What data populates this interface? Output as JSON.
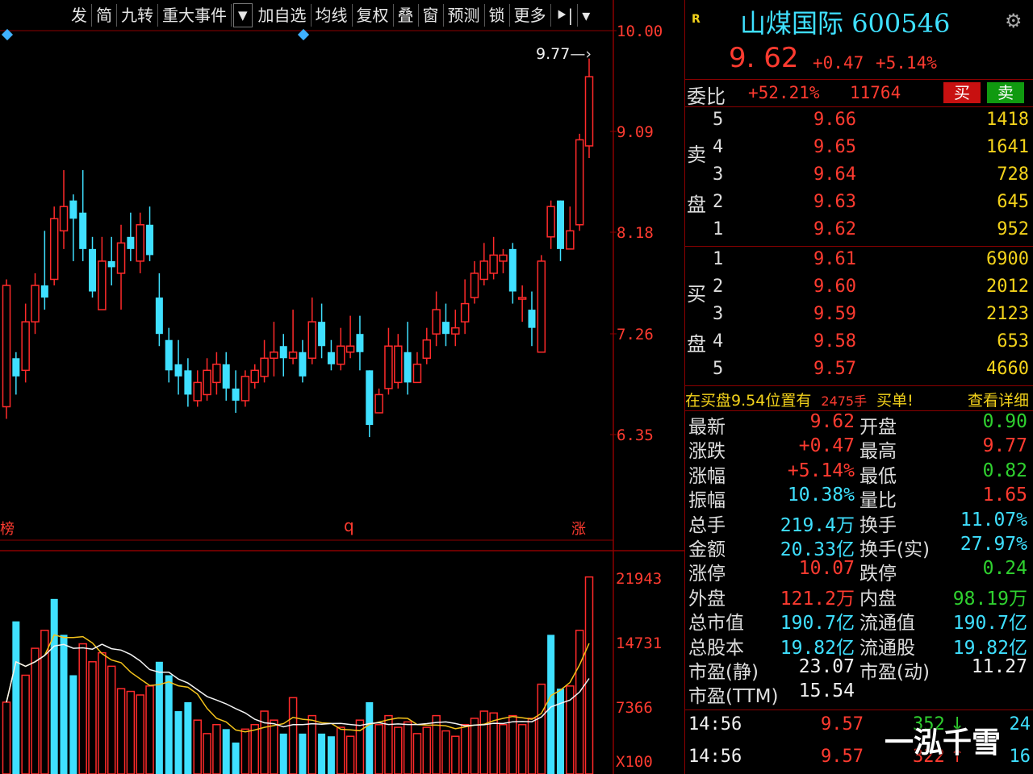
{
  "toolbar": {
    "items": [
      "发",
      "简",
      "九转",
      "重大事件",
      "加自选",
      "均线",
      "复权",
      "叠",
      "窗",
      "预测",
      "锁",
      "更多"
    ],
    "dropdown_glyph": "▼",
    "lock_glyph": "🔒",
    "expand_glyph": "⯈|",
    "menu_glyph": "▾"
  },
  "chart": {
    "price_axis": [
      "10.00",
      "9.09",
      "8.18",
      "7.26",
      "6.35"
    ],
    "volume_axis": [
      "21943",
      "14731",
      "7366",
      "X100"
    ],
    "high_marker": "9.77",
    "bottom_markers": [
      "榜",
      "q",
      "涨"
    ],
    "colors": {
      "up": "#ff2a2a",
      "down": "#3fe0ff",
      "ma1": "#f3f3f3",
      "ma2": "#f3c21b",
      "grid": "#8b0000"
    },
    "price_min": 5.8,
    "price_max": 10.0,
    "candles": [
      [
        6.9,
        7.9,
        7.95,
        6.8
      ],
      [
        7.3,
        7.15,
        7.35,
        7.0
      ],
      [
        7.2,
        7.6,
        7.75,
        7.1
      ],
      [
        7.6,
        7.9,
        8.0,
        7.5
      ],
      [
        7.9,
        7.8,
        8.35,
        7.7
      ],
      [
        7.95,
        8.45,
        8.55,
        7.9
      ],
      [
        8.35,
        8.55,
        8.85,
        8.2
      ],
      [
        8.6,
        8.45,
        8.65,
        8.1
      ],
      [
        8.5,
        8.2,
        8.85,
        8.1
      ],
      [
        8.2,
        7.85,
        8.3,
        7.8
      ],
      [
        7.7,
        8.1,
        8.3,
        7.7
      ],
      [
        8.1,
        8.05,
        8.3,
        7.9
      ],
      [
        8.0,
        8.25,
        8.4,
        7.7
      ],
      [
        8.3,
        8.2,
        8.5,
        8.1
      ],
      [
        8.1,
        8.4,
        8.5,
        8.0
      ],
      [
        8.4,
        8.15,
        8.55,
        8.1
      ],
      [
        7.8,
        7.5,
        8.0,
        7.4
      ],
      [
        7.45,
        7.2,
        7.55,
        7.1
      ],
      [
        7.25,
        7.15,
        7.45,
        7.0
      ],
      [
        7.2,
        7.0,
        7.3,
        6.9
      ],
      [
        6.95,
        7.1,
        7.2,
        6.9
      ],
      [
        7.0,
        7.2,
        7.3,
        6.95
      ],
      [
        7.1,
        7.25,
        7.35,
        7.0
      ],
      [
        7.25,
        7.05,
        7.35,
        6.95
      ],
      [
        7.05,
        6.95,
        7.2,
        6.85
      ],
      [
        6.95,
        7.15,
        7.2,
        6.9
      ],
      [
        7.1,
        7.2,
        7.25,
        7.05
      ],
      [
        7.15,
        7.3,
        7.45,
        7.1
      ],
      [
        7.3,
        7.35,
        7.6,
        7.15
      ],
      [
        7.4,
        7.3,
        7.5,
        7.15
      ],
      [
        7.3,
        7.35,
        7.7,
        7.25
      ],
      [
        7.35,
        7.15,
        7.45,
        7.1
      ],
      [
        7.3,
        7.6,
        7.8,
        7.25
      ],
      [
        7.6,
        7.4,
        7.75,
        7.3
      ],
      [
        7.35,
        7.25,
        7.45,
        7.2
      ],
      [
        7.25,
        7.4,
        7.55,
        7.2
      ],
      [
        7.35,
        7.4,
        7.65,
        7.3
      ],
      [
        7.5,
        7.35,
        7.65,
        7.2
      ],
      [
        7.2,
        6.75,
        7.2,
        6.65
      ],
      [
        6.85,
        7.0,
        7.05,
        6.85
      ],
      [
        7.05,
        7.4,
        7.55,
        7.0
      ],
      [
        7.1,
        7.4,
        7.5,
        7.05
      ],
      [
        7.35,
        7.1,
        7.6,
        7.0
      ],
      [
        7.1,
        7.25,
        7.35,
        7.1
      ],
      [
        7.3,
        7.45,
        7.55,
        7.25
      ],
      [
        7.5,
        7.7,
        7.85,
        7.4
      ],
      [
        7.6,
        7.5,
        7.75,
        7.4
      ],
      [
        7.5,
        7.55,
        7.7,
        7.4
      ],
      [
        7.6,
        7.75,
        7.95,
        7.5
      ],
      [
        7.8,
        8.0,
        8.1,
        7.75
      ],
      [
        7.95,
        8.1,
        8.25,
        7.9
      ],
      [
        8.0,
        8.15,
        8.3,
        7.95
      ],
      [
        8.1,
        8.15,
        8.2,
        8.0
      ],
      [
        8.2,
        7.85,
        8.25,
        7.75
      ],
      [
        7.8,
        7.8,
        7.9,
        7.6
      ],
      [
        7.7,
        7.55,
        7.85,
        7.4
      ],
      [
        7.35,
        8.1,
        8.15,
        7.35
      ],
      [
        8.3,
        8.55,
        8.6,
        8.2
      ],
      [
        8.6,
        8.2,
        8.6,
        8.1
      ],
      [
        8.2,
        8.35,
        8.55,
        8.2
      ],
      [
        8.4,
        9.1,
        9.15,
        8.35
      ],
      [
        9.05,
        9.62,
        9.77,
        8.95
      ]
    ],
    "vol_max": 22000,
    "volumes": [
      [
        8000,
        "u"
      ],
      [
        17000,
        "d"
      ],
      [
        11000,
        "u"
      ],
      [
        14000,
        "u"
      ],
      [
        16000,
        "u"
      ],
      [
        19500,
        "d"
      ],
      [
        15500,
        "d"
      ],
      [
        11000,
        "d"
      ],
      [
        14500,
        "u"
      ],
      [
        12500,
        "u"
      ],
      [
        13500,
        "u"
      ],
      [
        12000,
        "u"
      ],
      [
        9500,
        "u"
      ],
      [
        9200,
        "u"
      ],
      [
        8800,
        "u"
      ],
      [
        9800,
        "u"
      ],
      [
        12500,
        "d"
      ],
      [
        11000,
        "d"
      ],
      [
        7000,
        "d"
      ],
      [
        8000,
        "d"
      ],
      [
        6000,
        "u"
      ],
      [
        4500,
        "u"
      ],
      [
        5500,
        "u"
      ],
      [
        5000,
        "d"
      ],
      [
        3500,
        "d"
      ],
      [
        5000,
        "u"
      ],
      [
        5500,
        "u"
      ],
      [
        7000,
        "u"
      ],
      [
        6000,
        "u"
      ],
      [
        4500,
        "d"
      ],
      [
        8500,
        "u"
      ],
      [
        4500,
        "d"
      ],
      [
        6500,
        "u"
      ],
      [
        4500,
        "d"
      ],
      [
        4200,
        "d"
      ],
      [
        5200,
        "u"
      ],
      [
        4200,
        "u"
      ],
      [
        6000,
        "u"
      ],
      [
        8000,
        "d"
      ],
      [
        5500,
        "u"
      ],
      [
        6500,
        "u"
      ],
      [
        5200,
        "u"
      ],
      [
        5800,
        "u"
      ],
      [
        4500,
        "u"
      ],
      [
        5200,
        "u"
      ],
      [
        6500,
        "u"
      ],
      [
        4800,
        "u"
      ],
      [
        4200,
        "u"
      ],
      [
        5500,
        "u"
      ],
      [
        6200,
        "u"
      ],
      [
        7000,
        "u"
      ],
      [
        6800,
        "u"
      ],
      [
        5500,
        "u"
      ],
      [
        6500,
        "u"
      ],
      [
        5500,
        "u"
      ],
      [
        6200,
        "u"
      ],
      [
        10000,
        "u"
      ],
      [
        15500,
        "d"
      ],
      [
        9500,
        "d"
      ],
      [
        9800,
        "u"
      ],
      [
        16000,
        "u"
      ],
      [
        21943,
        "u"
      ]
    ]
  },
  "quote": {
    "r_mark": "R",
    "name": "山煤国际",
    "code": "600546",
    "price": "9. 62",
    "change": "+0.47",
    "change_pct": "+5.14%",
    "weibi_label": "委比",
    "weibi_pct": "+52.21%",
    "weibi_diff": "11764",
    "buy_label": "买",
    "sell_label": "卖",
    "sell_side_label": [
      "卖",
      "盘"
    ],
    "buy_side_label": [
      "买",
      "盘"
    ],
    "asks": [
      {
        "lv": "5",
        "price": "9.66",
        "vol": "1418"
      },
      {
        "lv": "4",
        "price": "9.65",
        "vol": "1641"
      },
      {
        "lv": "3",
        "price": "9.64",
        "vol": "728"
      },
      {
        "lv": "2",
        "price": "9.63",
        "vol": "645"
      },
      {
        "lv": "1",
        "price": "9.62",
        "vol": "952"
      }
    ],
    "bids": [
      {
        "lv": "1",
        "price": "9.61",
        "vol": "6900"
      },
      {
        "lv": "2",
        "price": "9.60",
        "vol": "2012"
      },
      {
        "lv": "3",
        "price": "9.59",
        "vol": "2123"
      },
      {
        "lv": "4",
        "price": "9.58",
        "vol": "653"
      },
      {
        "lv": "5",
        "price": "9.57",
        "vol": "4660"
      }
    ],
    "alert_text_a": "在买盘",
    "alert_price": "9.54",
    "alert_text_b": "位置有",
    "alert_vol": "2475手",
    "alert_text_c": "买单!",
    "alert_link": "查看详细",
    "stats": [
      {
        "l1": "最新",
        "v1": "9.62",
        "c1": "red",
        "l2": "开盘",
        "v2": "0.90",
        "c2": "green"
      },
      {
        "l1": "涨跌",
        "v1": "+0.47",
        "c1": "red",
        "l2": "最高",
        "v2": "9.77",
        "c2": "red"
      },
      {
        "l1": "涨幅",
        "v1": "+5.14%",
        "c1": "red",
        "l2": "最低",
        "v2": "0.82",
        "c2": "green"
      },
      {
        "l1": "振幅",
        "v1": "10.38%",
        "c1": "cyan",
        "l2": "量比",
        "v2": "1.65",
        "c2": "red"
      },
      {
        "l1": "总手",
        "v1": "219.4万",
        "c1": "cyan",
        "l2": "换手",
        "v2": "11.07%",
        "c2": "cyan"
      },
      {
        "l1": "金额",
        "v1": "20.33亿",
        "c1": "cyan",
        "l2": "换手(实)",
        "v2": "27.97%",
        "c2": "cyan"
      },
      {
        "l1": "涨停",
        "v1": "10.07",
        "c1": "red",
        "l2": "跌停",
        "v2": "0.24",
        "c2": "green"
      },
      {
        "l1": "外盘",
        "v1": "121.2万",
        "c1": "red",
        "l2": "内盘",
        "v2": "98.19万",
        "c2": "green"
      },
      {
        "l1": "总市值",
        "v1": "190.7亿",
        "c1": "cyan",
        "l2": "流通值",
        "v2": "190.7亿",
        "c2": "cyan"
      },
      {
        "l1": "总股本",
        "v1": "19.82亿",
        "c1": "cyan",
        "l2": "流通股",
        "v2": "19.82亿",
        "c2": "cyan"
      },
      {
        "l1": "市盈(静)",
        "v1": "23.07",
        "c1": "white",
        "l2": "市盈(动)",
        "v2": "11.27",
        "c2": "white"
      },
      {
        "l1": "市盈(TTM)",
        "v1": "15.54",
        "c1": "white",
        "l2": "",
        "v2": "",
        "c2": "white"
      }
    ],
    "ticks": [
      {
        "time": "14:56",
        "price": "9.57",
        "vol": "352",
        "dir": "↓",
        "count": "24"
      },
      {
        "time": "14:56",
        "price": "9.57",
        "vol": "322",
        "dir": "↑",
        "count": "16"
      }
    ],
    "watermark": "一泓千雪"
  }
}
